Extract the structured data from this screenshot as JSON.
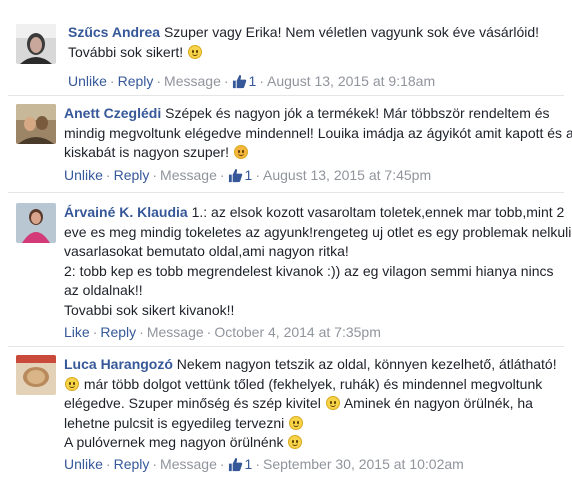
{
  "comments": [
    {
      "author": "Szűcs Andrea",
      "lines": [
        [
          "Szuper vagy Erika! Nem véletlen vagyunk sok éve vásárlóid!"
        ],
        [
          "További sok sikert! "
        ]
      ],
      "action_primary": "Unlike",
      "reply": "Reply",
      "message": "Message",
      "likes": "1",
      "date": "August 13, 2015 at 9:18am"
    },
    {
      "author": "Anett Czeglédi",
      "lines": [
        [
          "Szépek és nagyon jók a termékek! Már többször rendeltem és"
        ],
        [
          "mindig megvoltunk elégedve mindennel! Louika imádja az ágyikót amit kapott és a"
        ],
        [
          "kiskabát is nagyon szuper! "
        ]
      ],
      "action_primary": "Unlike",
      "reply": "Reply",
      "message": "Message",
      "likes": "1",
      "date": "August 13, 2015 at 7:45pm"
    },
    {
      "author": "Árvainé K. Klaudia",
      "lines": [
        [
          "1.: az elsok kozott vasaroltam toletek,ennek mar tobb,mint 2"
        ],
        [
          "eve es meg mindig tokeletes az agyunk!rengeteg uj otlet es egy problemak nelkuli"
        ],
        [
          "vasarlasokat bemutato oldal,ami nagyon ritka!"
        ],
        [
          "2: tobb kep es tobb megrendelest kivanok :)) az eg vilagon semmi hianya nincs"
        ],
        [
          "az oldalnak!!"
        ],
        [
          "Tovabbi sok sikert kivanok!!"
        ]
      ],
      "action_primary": "Like",
      "reply": "Reply",
      "message": "Message",
      "date": "October 4, 2014 at 7:35pm"
    },
    {
      "author": "Luca Harangozó",
      "lines": [
        [
          "Nekem nagyon tetszik az oldal, könnyen kezelhető, átlátható!"
        ],
        [
          "már több dolgot vettünk tőled (fekhelyek, ruhák) és mindennel megvoltunk"
        ],
        [
          "elégedve. Szuper minőség és szép kivitel ",
          " Aminek én nagyon örülnék, ha"
        ],
        [
          "lehetne pulcsit is egyedileg tervezni "
        ],
        [
          "A pulóvernek meg nagyon örülnénk "
        ]
      ],
      "action_primary": "Unlike",
      "reply": "Reply",
      "message": "Message",
      "likes": "1",
      "date": "September 30, 2015 at 10:02am"
    }
  ],
  "separator": "·",
  "colors": {
    "link": "#365899",
    "meta": "#90949c",
    "text": "#1d2129"
  },
  "icons": {
    "like": "thumbs-up-icon",
    "emoji": "smiley-icon"
  }
}
